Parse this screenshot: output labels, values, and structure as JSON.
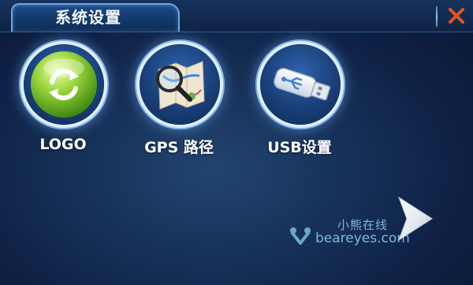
{
  "window": {
    "title": "系统设置",
    "close_icon": "close-icon"
  },
  "menu": {
    "items": [
      {
        "label": "LOGO",
        "icon": "refresh-icon"
      },
      {
        "label": "GPS 路径",
        "icon": "map-magnifier-icon"
      },
      {
        "label": "USB设置",
        "icon": "usb-drive-icon"
      }
    ]
  },
  "navigation": {
    "next_icon": "next-arrow-icon"
  },
  "watermark": {
    "brand_cn": "小熊在线",
    "brand_en": "beareyes.com"
  },
  "colors": {
    "background": "#17325a",
    "accent": "#6fa4e4",
    "close": "#e8541a"
  }
}
